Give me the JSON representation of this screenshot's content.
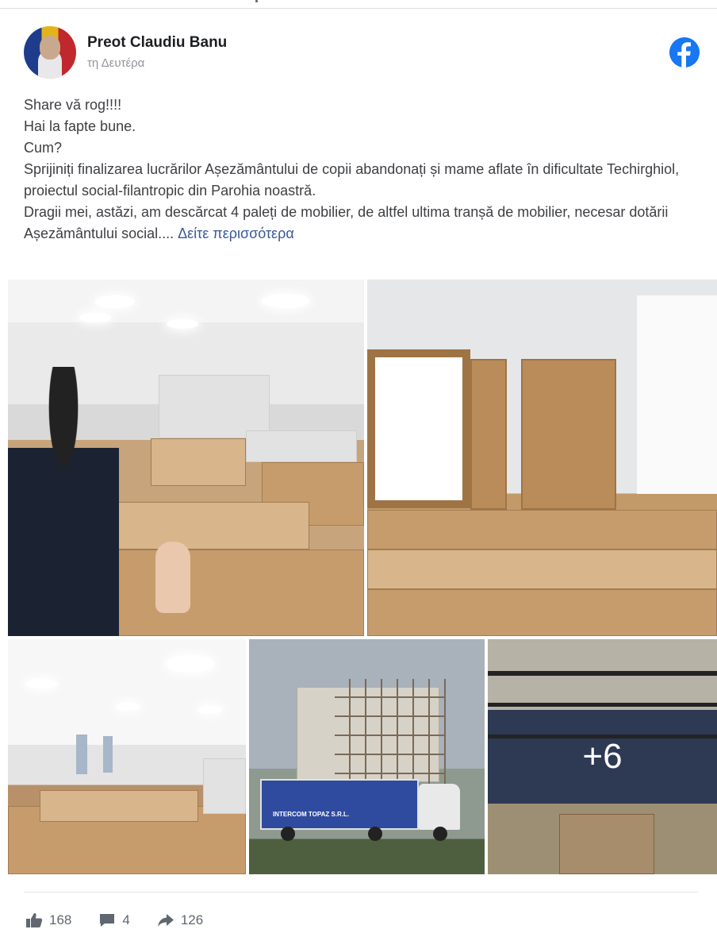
{
  "post": {
    "author": "Preot Claudiu Banu",
    "time": "τη Δευτέρα",
    "lines": [
      "Share vă rog!!!!",
      "Hai la fapte bune.",
      "Cum?",
      "Sprijiniți finalizarea lucrărilor Așezământului de copii abandonați și mame aflate în dificultate Techirghiol, proiectul social-filantropic din Parohia noastră.",
      "Dragii mei, astăzi, am descărcat 4 paleți de mobilier, de altfel ultima tranșă de mobilier, necesar dotării Așezământului social...."
    ],
    "see_more": "Δείτε περισσότερα"
  },
  "photos": {
    "more_count_label": "+6",
    "truck_lettering": "INTERCOM TOPAZ S.R.L."
  },
  "stats": {
    "likes": "168",
    "comments": "4",
    "shares": "126"
  },
  "colors": {
    "brand_blue": "#1877f2",
    "link": "#385898",
    "muted": "#606770"
  },
  "icons": {
    "brand": "facebook-logo-icon",
    "like": "thumbs-up-icon",
    "comment": "comment-bubble-icon",
    "share": "share-arrow-icon"
  }
}
